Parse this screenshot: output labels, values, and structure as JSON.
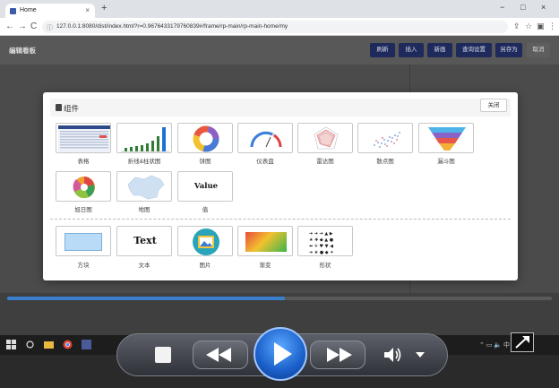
{
  "browser": {
    "tab_title": "Home",
    "new_tab": "+",
    "close_tab": "×",
    "url": "127.0.0.1:8080/dist/index.html?r=0.9676433179760839#/frame/rp-main/rp-main-home/my",
    "nav": {
      "back": "←",
      "forward": "→",
      "reload": "C"
    },
    "window": {
      "minimize": "−",
      "maximize": "□",
      "close": "×"
    }
  },
  "page": {
    "title": "编辑看板",
    "buttons": [
      "刷新",
      "插入",
      "新画",
      "查询设置",
      "另存为",
      "取消"
    ]
  },
  "modal": {
    "title": "组件",
    "close_label": "关闭",
    "row1": [
      "表格",
      "折线&柱状图",
      "饼图",
      "仪表盘",
      "雷达图",
      "散点图",
      "漏斗图"
    ],
    "row2": [
      "旭日图",
      "地图",
      "值"
    ],
    "row3": [
      "方块",
      "文本",
      "图片",
      "渐变",
      "形状"
    ],
    "value_card_text": "Value",
    "text_card_text": "Text"
  },
  "player": {
    "progress": 0.51
  },
  "colors": {
    "accent": "#1f2a5c",
    "play": "#1a5fc9",
    "seek_fill": "#3a7fd0"
  }
}
